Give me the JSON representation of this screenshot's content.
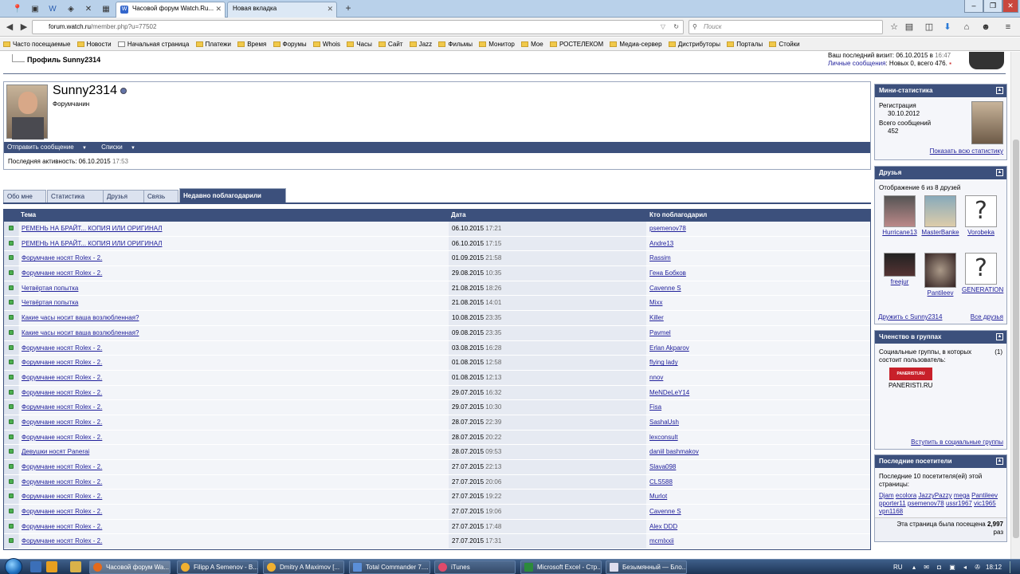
{
  "browser": {
    "tabs": [
      {
        "title": "Часовой форум Watch.Ru..."
      },
      {
        "title": "Новая вкладка"
      }
    ],
    "url_host": "forum.watch.ru",
    "url_path": "/member.php?u=77502",
    "search_placeholder": "Поиск",
    "bookmarks": [
      "Часто посещаемые",
      "Новости",
      "Начальная страница",
      "Платежи",
      "Время",
      "Форумы",
      "Whois",
      "Часы",
      "Сайт",
      "Jazz",
      "Фильмы",
      "Монитор",
      "Мое",
      "РОСТЕЛЕКОМ",
      "Медиа-сервер",
      "Дистрибуторы",
      "Порталы",
      "Стойки"
    ]
  },
  "header": {
    "breadcrumb": "Профиль Sunny2314",
    "last_visit": "Ваш последний визит: 06.10.2015 в",
    "last_visit_time": "16:47",
    "pm_link": "Личные сообщения",
    "pm_text": ": Новых 0, всего 476."
  },
  "profile": {
    "username": "Sunny2314",
    "rank": "Форумчанин",
    "send_message": "Отправить сообщение",
    "lists": "Списки",
    "last_activity_label": "Последняя активность: 06.10.2015",
    "last_activity_time": "17:53"
  },
  "tabs": [
    "Обо мне",
    "Статистика",
    "Друзья",
    "Связь",
    "Недавно поблагодарили"
  ],
  "thanks_table": {
    "headers": [
      "Тема",
      "Дата",
      "Кто поблагодарил"
    ],
    "rows": [
      {
        "topic": "РЕМЕНЬ НА БРАЙТ... КОПИЯ ИЛИ ОРИГИНАЛ",
        "date": "06.10.2015",
        "time": "17:21",
        "user": "psemenov78"
      },
      {
        "topic": "РЕМЕНЬ НА БРАЙТ... КОПИЯ ИЛИ ОРИГИНАЛ",
        "date": "06.10.2015",
        "time": "17:15",
        "user": "Andre13"
      },
      {
        "topic": "Форумчане носят Rolex - 2.",
        "date": "01.09.2015",
        "time": "21:58",
        "user": "Rassim"
      },
      {
        "topic": "Форумчане носят Rolex - 2.",
        "date": "29.08.2015",
        "time": "10:35",
        "user": "Гена Бобков"
      },
      {
        "topic": "Четвёртая попытка",
        "date": "21.08.2015",
        "time": "18:26",
        "user": "Cavenne S"
      },
      {
        "topic": "Четвёртая попытка",
        "date": "21.08.2015",
        "time": "14:01",
        "user": "Mixx"
      },
      {
        "topic": "Какие часы носит ваша возлюбленная?",
        "date": "10.08.2015",
        "time": "23:35",
        "user": "Killer"
      },
      {
        "topic": "Какие часы носит ваша возлюбленная?",
        "date": "09.08.2015",
        "time": "23:35",
        "user": "Pavmel"
      },
      {
        "topic": "Форумчане носят Rolex - 2.",
        "date": "03.08.2015",
        "time": "16:28",
        "user": "Erlan Akparov"
      },
      {
        "topic": "Форумчане носят Rolex - 2.",
        "date": "01.08.2015",
        "time": "12:58",
        "user": "flying lady"
      },
      {
        "topic": "Форумчане носят Rolex - 2.",
        "date": "01.08.2015",
        "time": "12:13",
        "user": "nnov"
      },
      {
        "topic": "Форумчане носят Rolex - 2.",
        "date": "29.07.2015",
        "time": "16:32",
        "user": "MeNDeLeY14"
      },
      {
        "topic": "Форумчане носят Rolex - 2.",
        "date": "29.07.2015",
        "time": "10:30",
        "user": "Fisa"
      },
      {
        "topic": "Форумчане носят Rolex - 2.",
        "date": "28.07.2015",
        "time": "22:39",
        "user": "SashaUsh"
      },
      {
        "topic": "Форумчане носят Rolex - 2.",
        "date": "28.07.2015",
        "time": "20:22",
        "user": "lexconsult"
      },
      {
        "topic": "Девушки носят Panerai",
        "date": "28.07.2015",
        "time": "09:53",
        "user": "daniil bashmakov"
      },
      {
        "topic": "Форумчане носят Rolex - 2.",
        "date": "27.07.2015",
        "time": "22:13",
        "user": "Slava098"
      },
      {
        "topic": "Форумчане носят Rolex - 2.",
        "date": "27.07.2015",
        "time": "20:06",
        "user": "CLS588"
      },
      {
        "topic": "Форумчане носят Rolex - 2.",
        "date": "27.07.2015",
        "time": "19:22",
        "user": "Murlot"
      },
      {
        "topic": "Форумчане носят Rolex - 2.",
        "date": "27.07.2015",
        "time": "19:06",
        "user": "Cavenne S"
      },
      {
        "topic": "Форумчане носят Rolex - 2.",
        "date": "27.07.2015",
        "time": "17:48",
        "user": "Alex DDD"
      },
      {
        "topic": "Форумчане носят Rolex - 2.",
        "date": "27.07.2015",
        "time": "17:31",
        "user": "mcmlxxii"
      }
    ]
  },
  "sidebar": {
    "mini_stats": {
      "title": "Мини-статистика",
      "reg_label": "Регистрация",
      "reg_date": "30.10.2012",
      "posts_label": "Всего сообщений",
      "posts_count": "452",
      "all_stats_link": "Показать всю статистику"
    },
    "friends": {
      "title": "Друзья",
      "summary": "Отображение 6 из 8 друзей",
      "list": [
        "Hurricane13",
        "MasterBanke",
        "Vorobeka",
        "freejur",
        "Pantileev",
        "GENERATION"
      ],
      "befriend_link": "Дружить с Sunny2314",
      "all_link": "Все друзья"
    },
    "groups": {
      "title": "Членство в группах",
      "text": "Социальные группы, в которых состоит пользователь:",
      "count": "(1)",
      "logo_text": "PANERISTI.RU",
      "group_name": "PANERISTI.RU",
      "join_link": "Вступить в социальные группы"
    },
    "visitors": {
      "title": "Последние посетители",
      "text": "Последние 10 посетителя(ей) этой страницы:",
      "names": [
        "Djam",
        "ecolora",
        "JazzyPazzy",
        "mega",
        "Pantileev",
        "pporter11",
        "psemenov78",
        "ussr1967",
        "vic1965",
        "vpn1168"
      ],
      "visits_label": "Эта страница была посещена",
      "visits_count": "2,997",
      "visits_suffix": "раз"
    }
  },
  "taskbar": {
    "tasks": [
      "Часовой форум Wa...",
      "Filipp A Semenov - В...",
      "Dmitry A Maximov [...",
      "Total Commander 7....",
      "iTunes",
      "Microsoft Excel - Стр...",
      "Безымянный — Бло..."
    ],
    "lang": "RU",
    "clock": "18:12"
  }
}
